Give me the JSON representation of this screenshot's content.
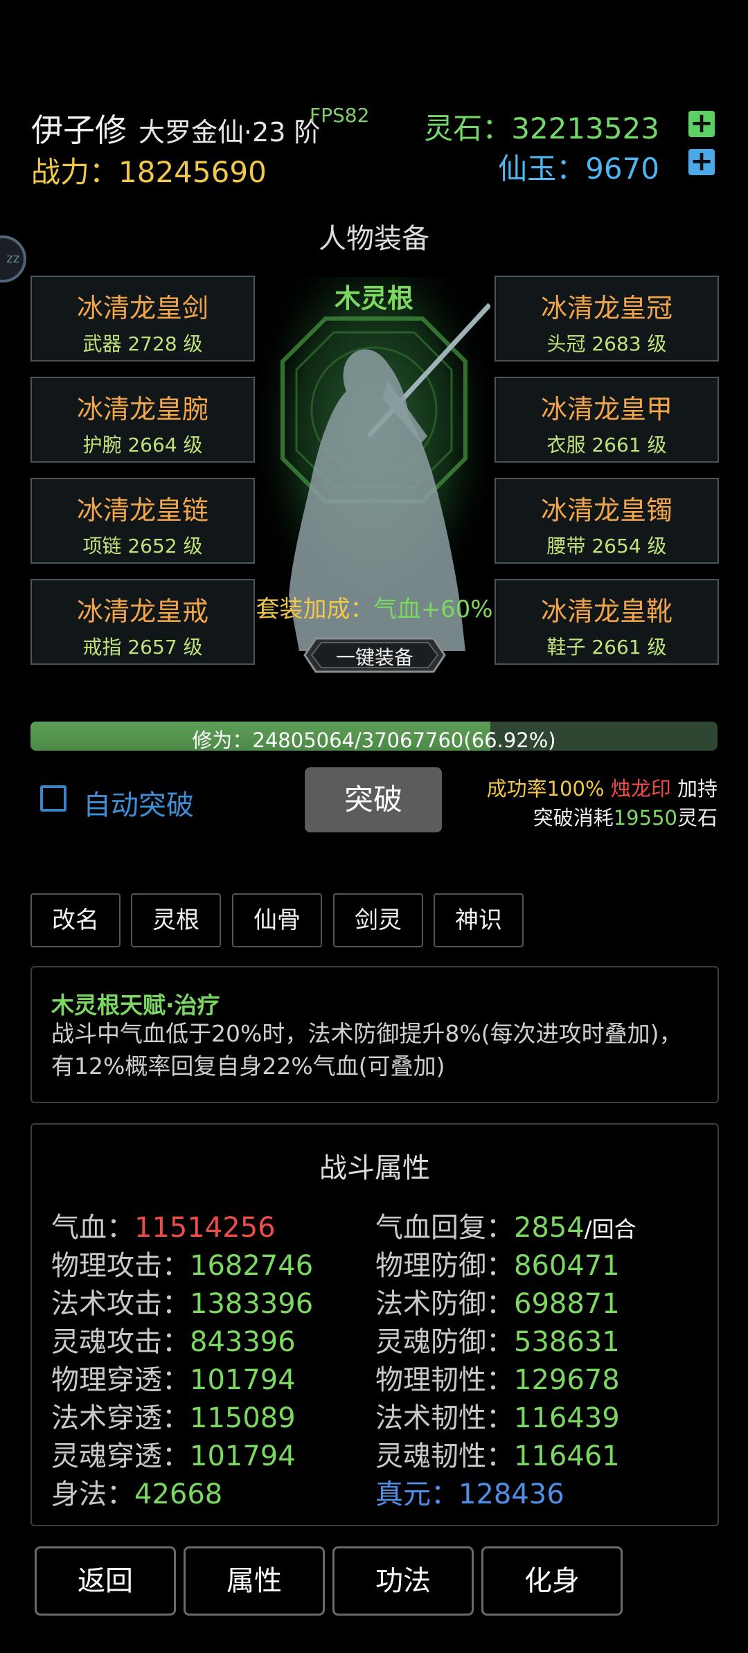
{
  "header": {
    "name": "伊子修",
    "realm": "大罗金仙·23 阶",
    "fps": "FPS82",
    "power_label": "战力：",
    "power_value": "18245690",
    "stone_label": "灵石：",
    "stone_value": "32213523",
    "jade_label": "仙玉：",
    "jade_value": "9670",
    "plus": "+"
  },
  "equipment": {
    "title": "人物装备",
    "root": "木灵根",
    "left": [
      {
        "name": "冰清龙皇剑",
        "sub": "武器 2728 级"
      },
      {
        "name": "冰清龙皇腕",
        "sub": "护腕 2664 级"
      },
      {
        "name": "冰清龙皇链",
        "sub": "项链 2652 级"
      },
      {
        "name": "冰清龙皇戒",
        "sub": "戒指 2657 级"
      }
    ],
    "right": [
      {
        "name": "冰清龙皇冠",
        "sub": "头冠 2683 级"
      },
      {
        "name": "冰清龙皇甲",
        "sub": "衣服 2661 级"
      },
      {
        "name": "冰清龙皇镯",
        "sub": "腰带 2654 级"
      },
      {
        "name": "冰清龙皇靴",
        "sub": "鞋子 2661 级"
      }
    ],
    "set_bonus_label": "套装加成：",
    "set_bonus_value": "气血+60%",
    "one_key_equip": "一键装备"
  },
  "cultivation": {
    "label": "修为：24805064/37067760(66.92%)",
    "progress": 0.6692
  },
  "breakthrough": {
    "auto_label": "自动突破",
    "button": "突破",
    "rate_label": "成功率100%",
    "seal": "烛龙印",
    "seal_suffix": "加持",
    "cost_label": "突破消耗",
    "cost_value": "19550",
    "cost_unit": "灵石"
  },
  "tabs": [
    "改名",
    "灵根",
    "仙骨",
    "剑灵",
    "神识"
  ],
  "talent": {
    "title": "木灵根天赋·治疗",
    "desc": "战斗中气血低于20%时，法术防御提升8%(每次进攻时叠加)，有12%概率回复自身22%气血(可叠加)"
  },
  "stats": {
    "title": "战斗属性",
    "left": [
      {
        "k": "气血：",
        "v": "11514256"
      },
      {
        "k": "物理攻击：",
        "v": "1682746"
      },
      {
        "k": "法术攻击：",
        "v": "1383396"
      },
      {
        "k": "灵魂攻击：",
        "v": "843396"
      },
      {
        "k": "物理穿透：",
        "v": "101794"
      },
      {
        "k": "法术穿透：",
        "v": "115089"
      },
      {
        "k": "灵魂穿透：",
        "v": "101794"
      },
      {
        "k": "身法：",
        "v": "42668"
      }
    ],
    "right": [
      {
        "k": "气血回复：",
        "v": "2854",
        "u": "/回合"
      },
      {
        "k": "物理防御：",
        "v": "860471"
      },
      {
        "k": "法术防御：",
        "v": "698871"
      },
      {
        "k": "灵魂防御：",
        "v": "538631"
      },
      {
        "k": "物理韧性：",
        "v": "129678"
      },
      {
        "k": "法术韧性：",
        "v": "116439"
      },
      {
        "k": "灵魂韧性：",
        "v": "116461"
      },
      {
        "k": "真元：",
        "v": "128436"
      }
    ]
  },
  "nav": [
    "返回",
    "属性",
    "功法",
    "化身"
  ]
}
